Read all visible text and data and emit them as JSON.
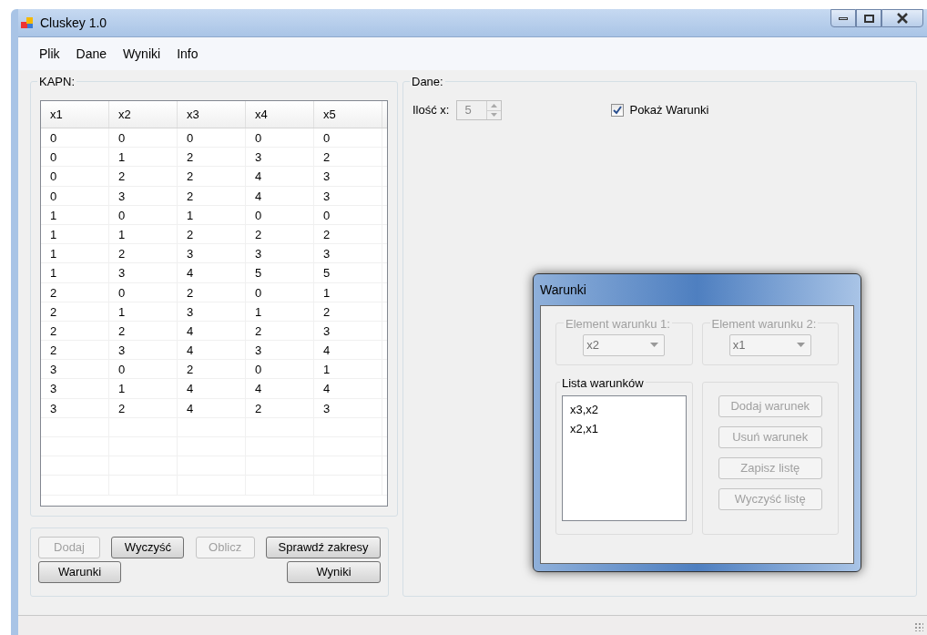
{
  "window": {
    "title": "Cluskey 1.0"
  },
  "menu": [
    {
      "label": "Plik"
    },
    {
      "label": "Dane"
    },
    {
      "label": "Wyniki"
    },
    {
      "label": "Info"
    }
  ],
  "kapn": {
    "title": "KAPN:",
    "columns": [
      "x1",
      "x2",
      "x3",
      "x4",
      "x5"
    ],
    "rows": [
      [
        "0",
        "0",
        "0",
        "0",
        "0"
      ],
      [
        "0",
        "1",
        "2",
        "3",
        "2"
      ],
      [
        "0",
        "2",
        "2",
        "4",
        "3"
      ],
      [
        "0",
        "3",
        "2",
        "4",
        "3"
      ],
      [
        "1",
        "0",
        "1",
        "0",
        "0"
      ],
      [
        "1",
        "1",
        "2",
        "2",
        "2"
      ],
      [
        "1",
        "2",
        "3",
        "3",
        "3"
      ],
      [
        "1",
        "3",
        "4",
        "5",
        "5"
      ],
      [
        "2",
        "0",
        "2",
        "0",
        "1"
      ],
      [
        "2",
        "1",
        "3",
        "1",
        "2"
      ],
      [
        "2",
        "2",
        "4",
        "2",
        "3"
      ],
      [
        "2",
        "3",
        "4",
        "3",
        "4"
      ],
      [
        "3",
        "0",
        "2",
        "0",
        "1"
      ],
      [
        "3",
        "1",
        "4",
        "4",
        "4"
      ],
      [
        "3",
        "2",
        "4",
        "2",
        "3"
      ]
    ]
  },
  "button_rows": [
    [
      {
        "label": "Dodaj",
        "disabled": true
      },
      {
        "label": "Wyczyść",
        "disabled": false
      },
      {
        "label": "Oblicz",
        "disabled": true
      },
      {
        "label": "Sprawdź zakresy",
        "disabled": false
      }
    ],
    [
      {
        "label": "Warunki",
        "disabled": false
      },
      {
        "label": "Wyniki",
        "disabled": false
      }
    ]
  ],
  "dane": {
    "title": "Dane:",
    "count_label": "Ilość x:",
    "count_value": "5",
    "count_disabled": true,
    "show_conditions": {
      "label": "Pokaż Warunki",
      "checked": true
    }
  },
  "dialog": {
    "title": "Warunki",
    "elements": [
      {
        "label": "Element warunku 1:",
        "value": "x2",
        "disabled": true
      },
      {
        "label": "Element warunku 2:",
        "value": "x1",
        "disabled": true
      }
    ],
    "list_title": "Lista warunków",
    "list_items": [
      "x3,x2",
      "x2,x1"
    ],
    "buttons": [
      {
        "label": "Dodaj warunek",
        "disabled": true
      },
      {
        "label": "Usuń warunek",
        "disabled": true
      },
      {
        "label": "Zapisz listę",
        "disabled": true
      },
      {
        "label": "Wyczyść listę",
        "disabled": true
      }
    ]
  }
}
